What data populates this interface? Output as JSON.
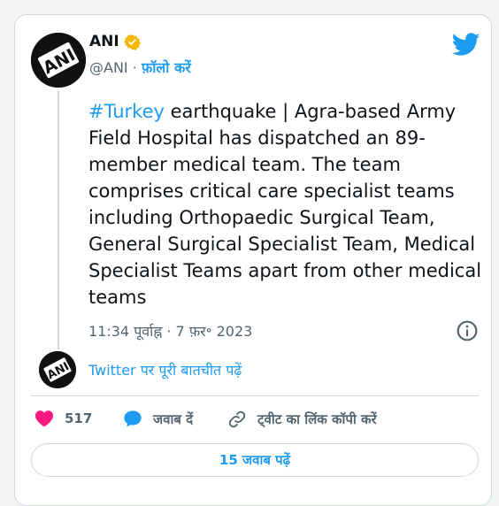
{
  "author": {
    "name": "ANI",
    "handle": "@ANI",
    "separator": " · ",
    "follow_label": "फ़ॉलो करें",
    "avatar_text": "ANI"
  },
  "tweet": {
    "hashtag": "#Turkey",
    "body": " earthquake | Agra-based Army Field Hospital has dispatched an 89-member medical team. The team comprises critical care specialist teams including Orthopaedic Surgical Team, General Surgical Specialist Team, Medical Specialist Teams apart from other medical teams",
    "time": "11:34 पूर्वाह्न",
    "date_separator": " · ",
    "date": "7 फ़र॰ 2023"
  },
  "conversation_link": "Twitter पर पूरी बातचीत पढ़ें",
  "actions": {
    "like_count": "517",
    "reply_label": "जवाब दें",
    "copy_link_label": "ट्वीट का लिंक कॉपी करें"
  },
  "replies_button_label": "15 जवाब पढ़ें",
  "colors": {
    "accent": "#1d9bf0",
    "like": "#f91880",
    "verified": "#f5b600"
  },
  "icons": {
    "verified": "verified-badge-icon",
    "brand": "twitter-bird-icon",
    "info": "info-icon",
    "like": "heart-icon",
    "reply": "speech-bubble-icon",
    "copy": "link-icon"
  }
}
